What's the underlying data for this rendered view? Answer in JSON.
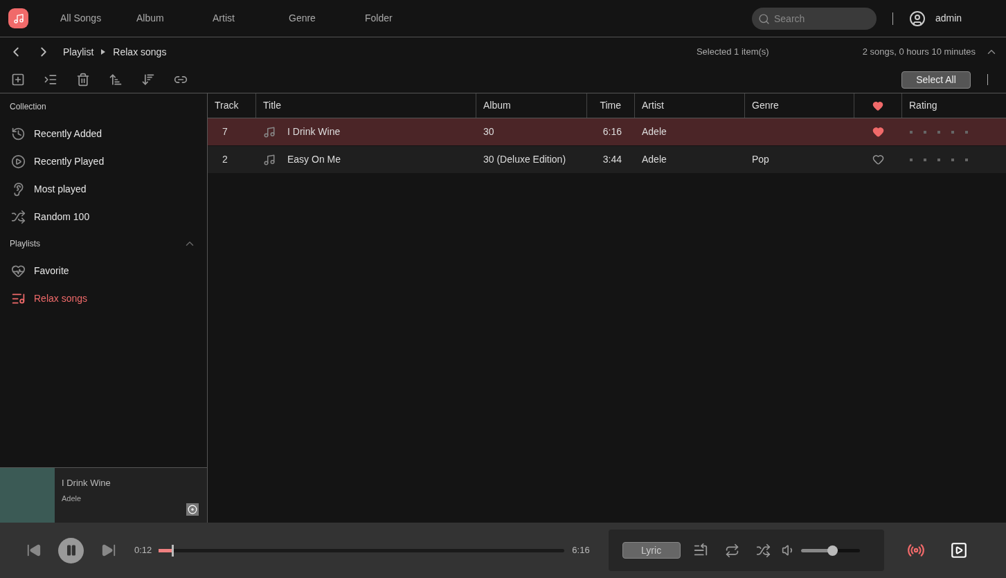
{
  "nav": {
    "tabs": [
      {
        "label": "All Songs",
        "selected": false
      },
      {
        "label": "Album",
        "selected": false
      },
      {
        "label": "Artist",
        "selected": false
      },
      {
        "label": "Genre",
        "selected": false
      },
      {
        "label": "Folder",
        "selected": false
      }
    ],
    "search": {
      "placeholder": "Search"
    },
    "user": "admin"
  },
  "breadcrumb": [
    "Playlist",
    "Relax songs"
  ],
  "selection_info": "Selected 1 item(s)",
  "summary": "2 songs, 0 hours 10 minutes",
  "select_all": "Select All",
  "sidebar": {
    "sections": [
      {
        "title": "Collection",
        "items": [
          {
            "label": "Recently Added",
            "selected": false
          },
          {
            "label": "Recently Played",
            "selected": false
          },
          {
            "label": "Most played",
            "selected": false
          },
          {
            "label": "Random 100",
            "selected": false
          }
        ]
      },
      {
        "title": "Playlists",
        "expanded": true,
        "items": [
          {
            "label": "Favorite",
            "selected": false
          },
          {
            "label": "Relax songs",
            "selected": true
          }
        ]
      }
    ]
  },
  "table": {
    "columns": [
      "Track",
      "Title",
      "Album",
      "Time",
      "Artist",
      "Genre",
      "",
      "Rating"
    ],
    "rows": [
      {
        "track": "7",
        "title": "I Drink Wine",
        "album": "30",
        "time": "6:16",
        "artist": "Adele",
        "genre": "",
        "favorite": true,
        "stars": 0,
        "selected": true
      },
      {
        "track": "2",
        "title": "Easy On Me",
        "album": "30 (Deluxe Edition)",
        "time": "3:44",
        "artist": "Adele",
        "genre": "Pop",
        "favorite": false,
        "stars": 0,
        "selected": false
      }
    ]
  },
  "now_playing": {
    "title": "I Drink Wine",
    "artist": "Adele"
  },
  "player": {
    "playing": true,
    "elapsed": "0:12",
    "duration": "6:16",
    "level": 0.033,
    "lyric": "Lyric",
    "volume": {
      "level": 0.5
    },
    "broadcast_on": true
  }
}
